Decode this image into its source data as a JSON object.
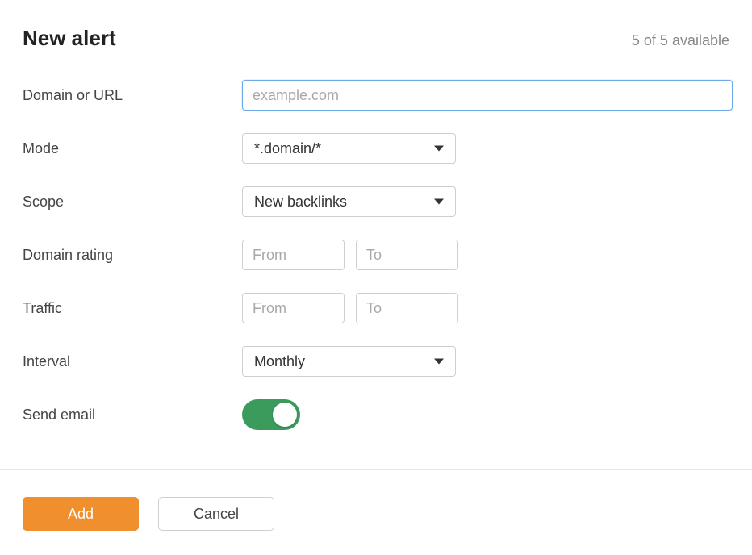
{
  "header": {
    "title": "New alert",
    "availability": "5 of 5 available"
  },
  "labels": {
    "domain_or_url": "Domain or URL",
    "mode": "Mode",
    "scope": "Scope",
    "domain_rating": "Domain rating",
    "traffic": "Traffic",
    "interval": "Interval",
    "send_email": "Send email"
  },
  "fields": {
    "domain_or_url": {
      "value": "",
      "placeholder": "example.com"
    },
    "mode": {
      "selected": "*.domain/*"
    },
    "scope": {
      "selected": "New backlinks"
    },
    "domain_rating": {
      "from": {
        "value": "",
        "placeholder": "From"
      },
      "to": {
        "value": "",
        "placeholder": "To"
      }
    },
    "traffic": {
      "from": {
        "value": "",
        "placeholder": "From"
      },
      "to": {
        "value": "",
        "placeholder": "To"
      }
    },
    "interval": {
      "selected": "Monthly"
    },
    "send_email": {
      "on": true
    }
  },
  "buttons": {
    "add": "Add",
    "cancel": "Cancel"
  }
}
